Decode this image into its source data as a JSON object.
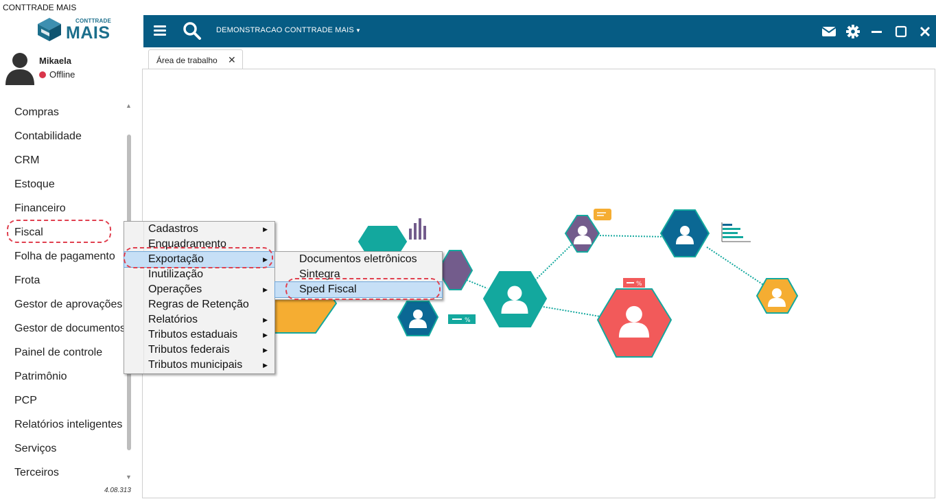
{
  "app": {
    "window_title": "CONTTRADE MAIS"
  },
  "brand": {
    "small": "CONTTRADE",
    "big": "MAIS"
  },
  "user": {
    "name": "Mikaela",
    "status": "Offline",
    "status_color": "#d9354a"
  },
  "sidebar": {
    "items": [
      {
        "label": "Compras"
      },
      {
        "label": "Contabilidade"
      },
      {
        "label": "CRM"
      },
      {
        "label": "Estoque"
      },
      {
        "label": "Financeiro"
      },
      {
        "label": "Fiscal"
      },
      {
        "label": "Folha de pagamento"
      },
      {
        "label": "Frota"
      },
      {
        "label": "Gestor de aprovações"
      },
      {
        "label": "Gestor de documentos"
      },
      {
        "label": "Painel de controle"
      },
      {
        "label": "Patrimônio"
      },
      {
        "label": "PCP"
      },
      {
        "label": "Relatórios inteligentes"
      },
      {
        "label": "Serviços"
      },
      {
        "label": "Terceiros"
      }
    ],
    "version": "4.08.313"
  },
  "topbar": {
    "company": "DEMONSTRACAO CONTTRADE MAIS",
    "icons": [
      "menu-icon",
      "search-icon",
      "mail-icon",
      "gear-icon",
      "minimize-icon",
      "maximize-icon",
      "close-icon"
    ],
    "color": "#065c84"
  },
  "tabs": [
    {
      "label": "Área de trabalho"
    }
  ],
  "fiscal_menu": {
    "items": [
      {
        "label": "Cadastros",
        "submenu": true
      },
      {
        "label": "Enquadramento",
        "submenu": false
      },
      {
        "label": "Exportação",
        "submenu": true,
        "highlighted": true
      },
      {
        "label": "Inutilização",
        "submenu": false
      },
      {
        "label": "Operações",
        "submenu": true
      },
      {
        "label": "Regras de Retenção",
        "submenu": false
      },
      {
        "label": "Relatórios",
        "submenu": true
      },
      {
        "label": "Tributos estaduais",
        "submenu": true
      },
      {
        "label": "Tributos federais",
        "submenu": true
      },
      {
        "label": "Tributos municipais",
        "submenu": true
      }
    ]
  },
  "export_menu": {
    "items": [
      {
        "label": "Documentos eletrônicos"
      },
      {
        "label": "Sintegra"
      },
      {
        "label": "Sped Fiscal",
        "highlighted": true
      }
    ]
  },
  "colors": {
    "teal": "#13a89e",
    "purple": "#735c8c",
    "blue": "#0b6894",
    "orange": "#f5ad32",
    "red": "#f25a5a",
    "highlight": "#e0404f"
  }
}
